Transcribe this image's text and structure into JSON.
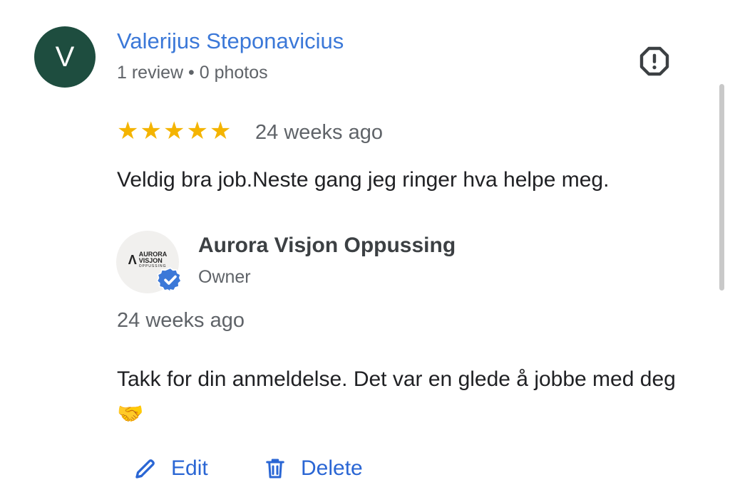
{
  "reviewer": {
    "initial": "V",
    "name": "Valerijus Steponavicius",
    "meta": "1 review • 0 photos",
    "avatar_color": "#1e4d3f"
  },
  "report_icon": "report-octagon-icon",
  "review": {
    "rating": 5,
    "rating_max": 5,
    "time": "24 weeks ago",
    "text": "Veldig bra job.Neste gang jeg ringer hva helpe meg."
  },
  "owner": {
    "logo": {
      "line1": "AURORA",
      "line2": "VISJON",
      "line3": "OPPUSSING"
    },
    "name": "Aurora Visjon Oppussing",
    "role": "Owner",
    "reply_time": "24 weeks ago",
    "reply_text": "Takk for din anmeldelse. Det var en glede å jobbe med deg 🤝"
  },
  "actions": {
    "edit_label": "Edit",
    "delete_label": "Delete"
  },
  "colors": {
    "accent": "#2a66d4",
    "name_link": "#3b78d8",
    "star": "#f4b400",
    "verified": "#3b78d8"
  }
}
